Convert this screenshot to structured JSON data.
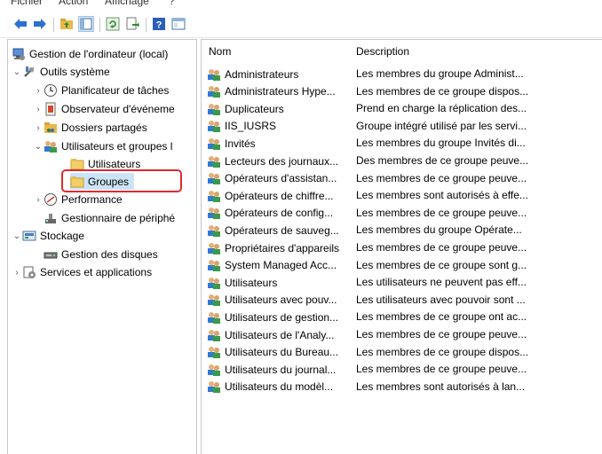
{
  "menubar": {
    "items": [
      "Fichier",
      "Action",
      "Affichage",
      "?"
    ]
  },
  "toolbar": {
    "buttons": [
      "back-icon",
      "forward-icon",
      "up-folder-icon",
      "show-hide-tree-icon",
      "refresh-icon",
      "export-list-icon",
      "help-icon",
      "mmc-icon"
    ]
  },
  "tree": {
    "root": "Gestion de l'ordinateur (local)",
    "system_tools": "Outils système",
    "task_scheduler": "Planificateur de tâches",
    "event_viewer": "Observateur d'événeme",
    "shared_folders": "Dossiers partagés",
    "local_users_groups": "Utilisateurs et groupes l",
    "users": "Utilisateurs",
    "groups": "Groupes",
    "performance": "Performance",
    "device_manager": "Gestionnaire de périphé",
    "storage": "Stockage",
    "disk_management": "Gestion des disques",
    "services_apps": "Services et applications"
  },
  "list": {
    "columns": {
      "name": "Nom",
      "description": "Description"
    },
    "rows": [
      {
        "name": "Administrateurs",
        "description": "Les membres du groupe Administ..."
      },
      {
        "name": "Administrateurs Hype...",
        "description": "Les membres de ce groupe dispos..."
      },
      {
        "name": "Duplicateurs",
        "description": "Prend en charge la réplication des..."
      },
      {
        "name": "IIS_IUSRS",
        "description": "Groupe intégré utilisé par les servi..."
      },
      {
        "name": "Invités",
        "description": "Les membres du groupe Invités di..."
      },
      {
        "name": "Lecteurs des journaux...",
        "description": "Des membres de ce groupe peuve..."
      },
      {
        "name": "Opérateurs d'assistan...",
        "description": "Les membres de ce groupe peuve..."
      },
      {
        "name": "Opérateurs de chiffre...",
        "description": "Les membres sont autorisés à effe..."
      },
      {
        "name": "Opérateurs de config...",
        "description": "Les membres de ce groupe peuve..."
      },
      {
        "name": "Opérateurs de sauveg...",
        "description": "Les membres du groupe Opérate..."
      },
      {
        "name": "Propriétaires d'appareils",
        "description": "Les membres de ce groupe peuve..."
      },
      {
        "name": "System Managed Acc...",
        "description": "Les membres de ce groupe sont g..."
      },
      {
        "name": "Utilisateurs",
        "description": "Les utilisateurs ne peuvent pas eff..."
      },
      {
        "name": "Utilisateurs avec pouv...",
        "description": "Les utilisateurs avec pouvoir sont ..."
      },
      {
        "name": "Utilisateurs de gestion...",
        "description": "Les membres de ce groupe ont ac..."
      },
      {
        "name": "Utilisateurs de l'Analy...",
        "description": "Les membres de ce groupe peuve..."
      },
      {
        "name": "Utilisateurs du Bureau...",
        "description": "Les membres de ce groupe dispos..."
      },
      {
        "name": "Utilisateurs du journal...",
        "description": "Les membres de ce groupe peuve..."
      },
      {
        "name": "Utilisateurs du modèl...",
        "description": "Les membres sont autorisés à lan..."
      }
    ]
  },
  "highlight_color": "#e0282e"
}
